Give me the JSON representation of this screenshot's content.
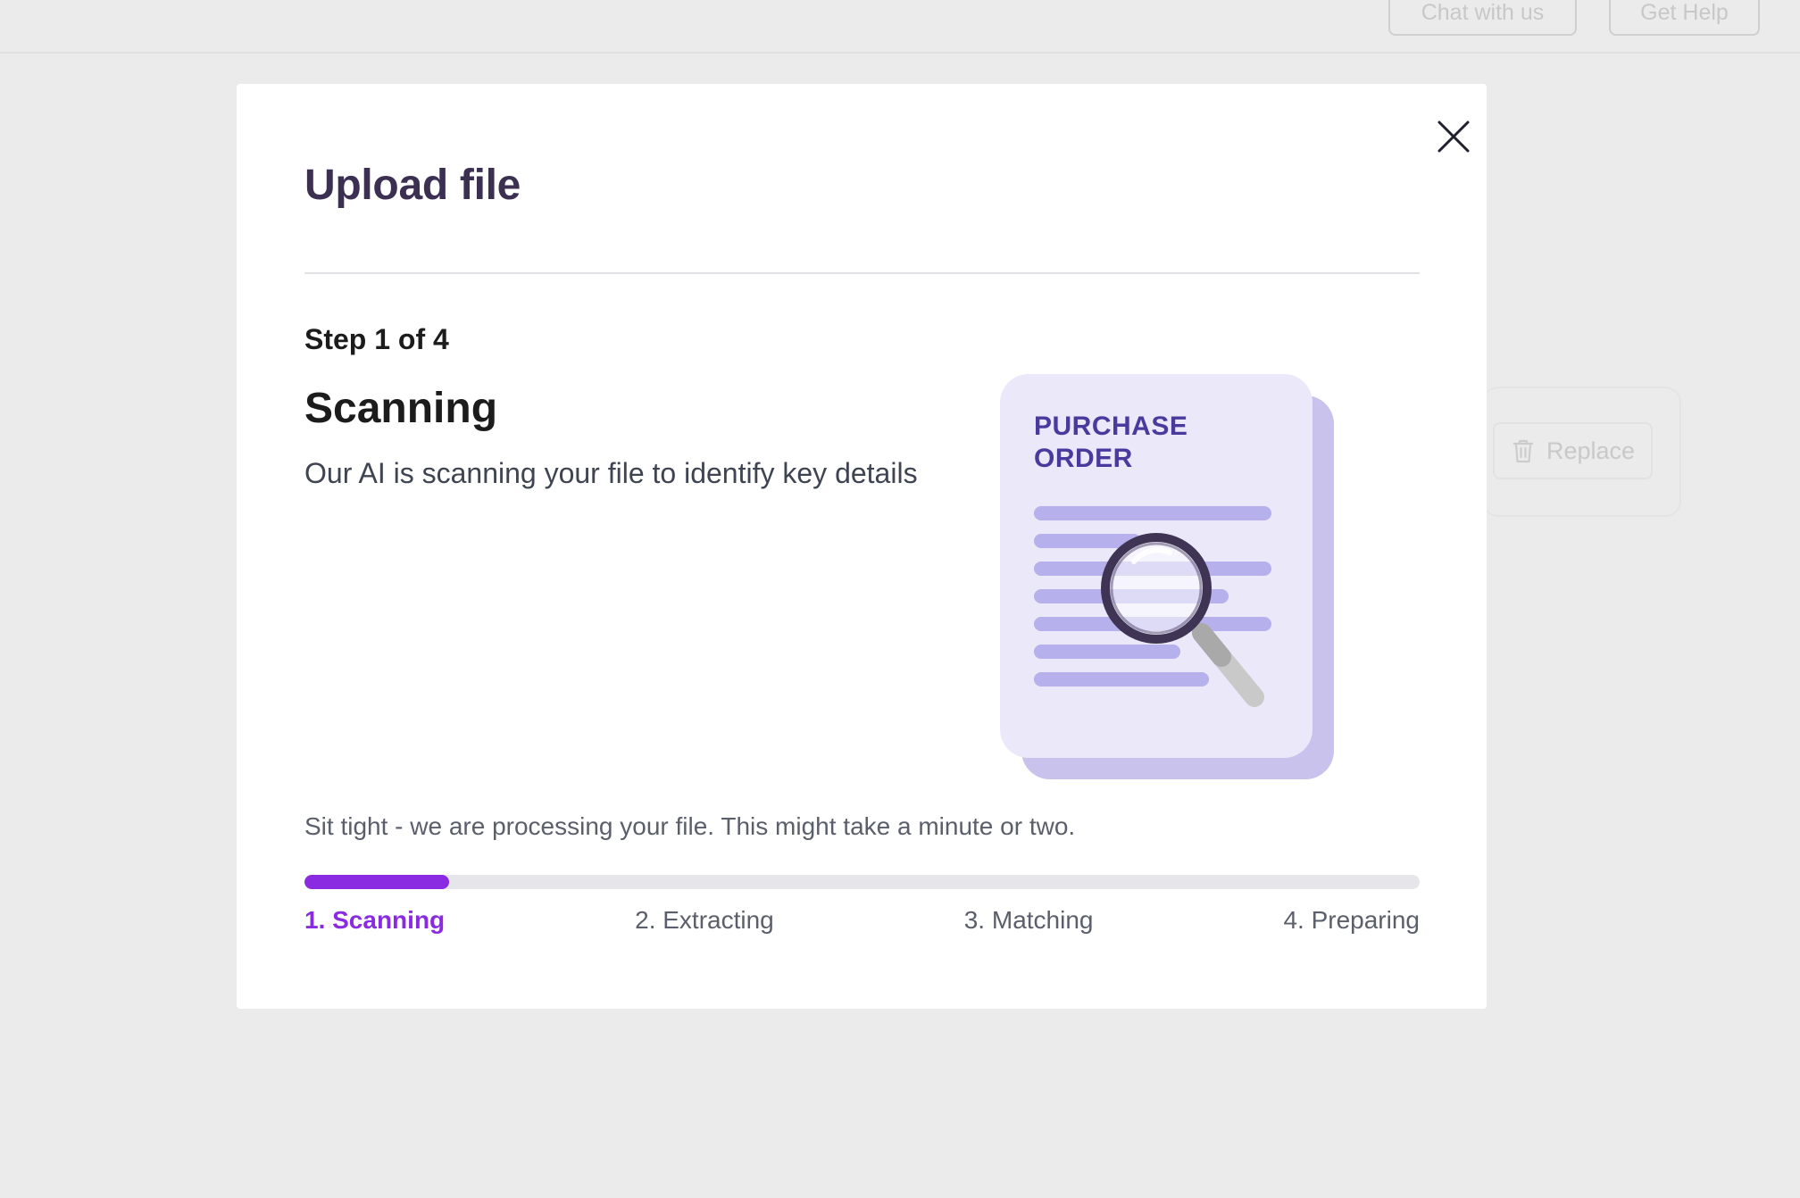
{
  "header": {
    "chat_label": "Chat with us",
    "help_label": "Get Help"
  },
  "background": {
    "replace_label": "Replace"
  },
  "modal": {
    "title": "Upload file",
    "step_label": "Step 1 of 4",
    "step_title": "Scanning",
    "step_description": "Our AI is scanning your file to identify key details",
    "illustration": {
      "line1": "PURCHASE",
      "line2": "ORDER",
      "icon": "document-magnifier-icon"
    },
    "status_text": "Sit tight - we are processing your file. This might take a minute or two.",
    "progress_percent": 13,
    "steps": [
      {
        "label": "1. Scanning"
      },
      {
        "label": "2. Extracting"
      },
      {
        "label": "3. Matching"
      },
      {
        "label": "4. Preparing"
      }
    ]
  },
  "colors": {
    "accent": "#8a2be2",
    "title": "#3b2f52",
    "backdrop": "#ebebeb"
  }
}
